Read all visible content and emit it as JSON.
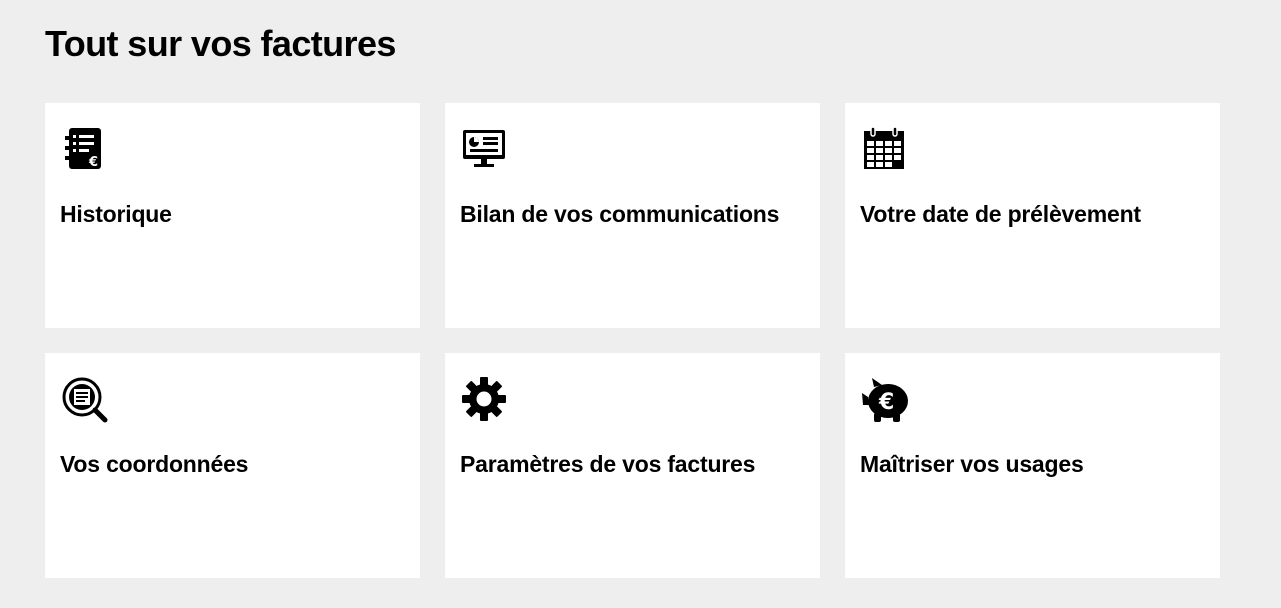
{
  "page": {
    "title": "Tout sur vos factures"
  },
  "cards": [
    {
      "label": "Historique",
      "icon": "invoice-euro-icon"
    },
    {
      "label": "Bilan de vos communications",
      "icon": "monitor-report-icon"
    },
    {
      "label": "Votre date de prélèvement",
      "icon": "calendar-icon"
    },
    {
      "label": "Vos coordonnées",
      "icon": "document-search-icon"
    },
    {
      "label": "Paramètres de vos factures",
      "icon": "gear-icon"
    },
    {
      "label": "Maîtriser vos usages",
      "icon": "piggy-bank-euro-icon"
    }
  ],
  "colors": {
    "background": "#eeeeee",
    "card": "#ffffff",
    "text": "#000000"
  }
}
